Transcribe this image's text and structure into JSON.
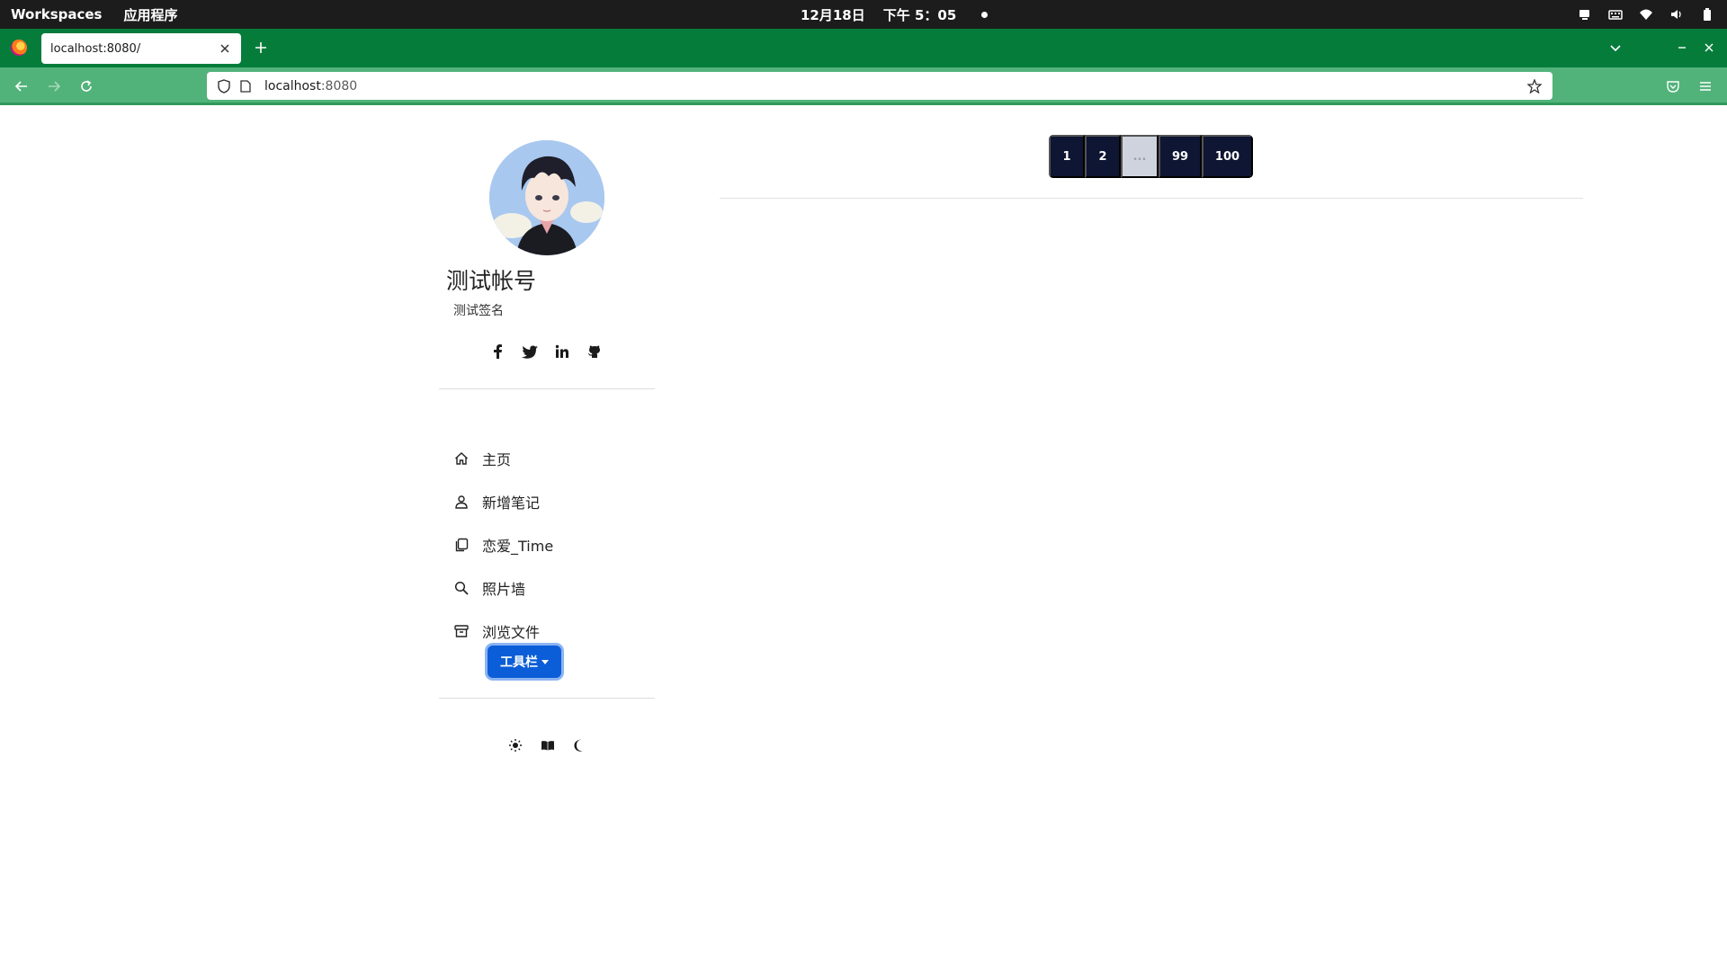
{
  "desktop": {
    "workspaces_label": "Workspaces",
    "apps_label": "应用程序",
    "date": "12月18日",
    "time": "下午 5：05"
  },
  "browser": {
    "tab_title": "localhost:8080/",
    "url_host": "localhost",
    "url_port": ":8080"
  },
  "profile": {
    "name": "测试帐号",
    "signature": "测试签名",
    "socials": [
      "facebook-icon",
      "twitter-icon",
      "linkedin-icon",
      "github-icon"
    ]
  },
  "menu": {
    "items": [
      {
        "label": "主页",
        "icon": "home-icon"
      },
      {
        "label": "新增笔记",
        "icon": "user-icon"
      },
      {
        "label": "恋爱_Time",
        "icon": "copy-icon"
      },
      {
        "label": "照片墙",
        "icon": "search-icon"
      },
      {
        "label": "浏览文件",
        "icon": "archive-icon"
      }
    ],
    "toolbar_label": "工具栏"
  },
  "themes": [
    "sun-icon",
    "book-icon",
    "moon-icon"
  ],
  "pagination": {
    "pages": [
      "1",
      "2",
      "...",
      "99",
      "100"
    ]
  },
  "colors": {
    "tab_strip": "#067c3b",
    "nav_bar": "#52b37a",
    "primary_button": "#0b5ed7",
    "pagination_bg": "#0e1633"
  }
}
